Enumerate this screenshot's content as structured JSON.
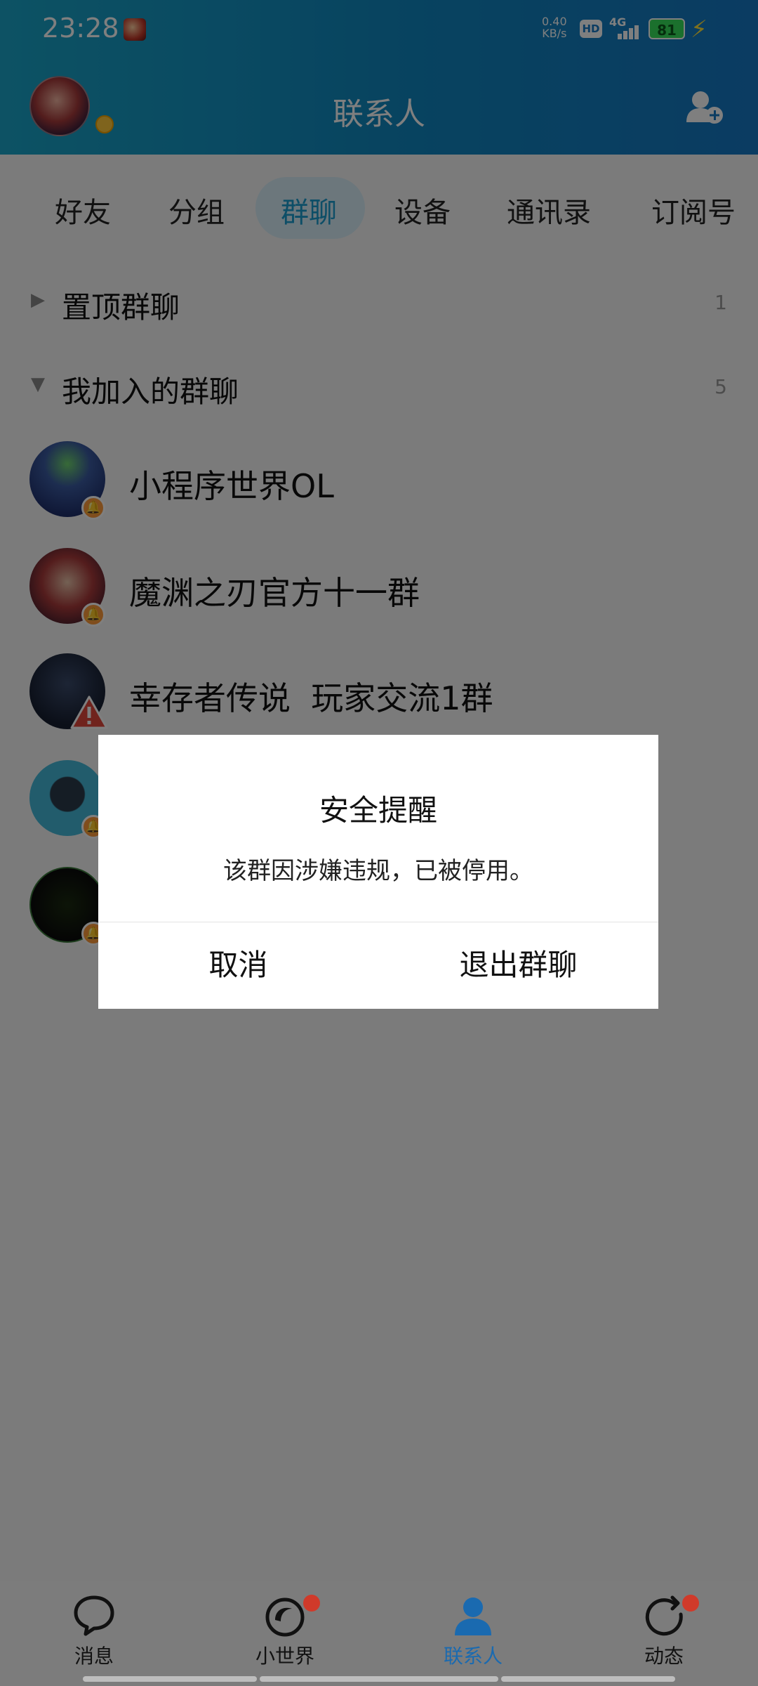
{
  "status_bar": {
    "time": "23:28",
    "net_speed_value": "0.40",
    "net_speed_unit": "KB/s",
    "hd_label": "HD",
    "network_label": "4G",
    "battery_level": "81"
  },
  "header": {
    "title": "联系人"
  },
  "tabs": [
    {
      "label": "好友"
    },
    {
      "label": "分组"
    },
    {
      "label": "群聊",
      "active": true
    },
    {
      "label": "设备"
    },
    {
      "label": "通讯录"
    },
    {
      "label": "订阅号"
    }
  ],
  "sections": {
    "pinned": {
      "label": "置顶群聊",
      "count": "1"
    },
    "joined": {
      "label": "我加入的群聊",
      "count": "5"
    }
  },
  "groups": [
    {
      "name": "小程序世界OL"
    },
    {
      "name": "魔渊之刃官方十一群"
    },
    {
      "name": "幸存者传说  玩家交流1群"
    }
  ],
  "dialog": {
    "title": "安全提醒",
    "message": "该群因涉嫌违规，已被停用。",
    "cancel_label": "取消",
    "exit_label": "退出群聊"
  },
  "bottom_nav": [
    {
      "label": "消息"
    },
    {
      "label": "小世界"
    },
    {
      "label": "联系人",
      "active": true
    },
    {
      "label": "动态"
    }
  ],
  "colors": {
    "header_gradient_start": "#1aa5c8",
    "header_gradient_end": "#1678c4",
    "active_tab": "#1a9ccf",
    "active_nav": "#1a6ab0",
    "badge_red": "#d03a2a"
  }
}
